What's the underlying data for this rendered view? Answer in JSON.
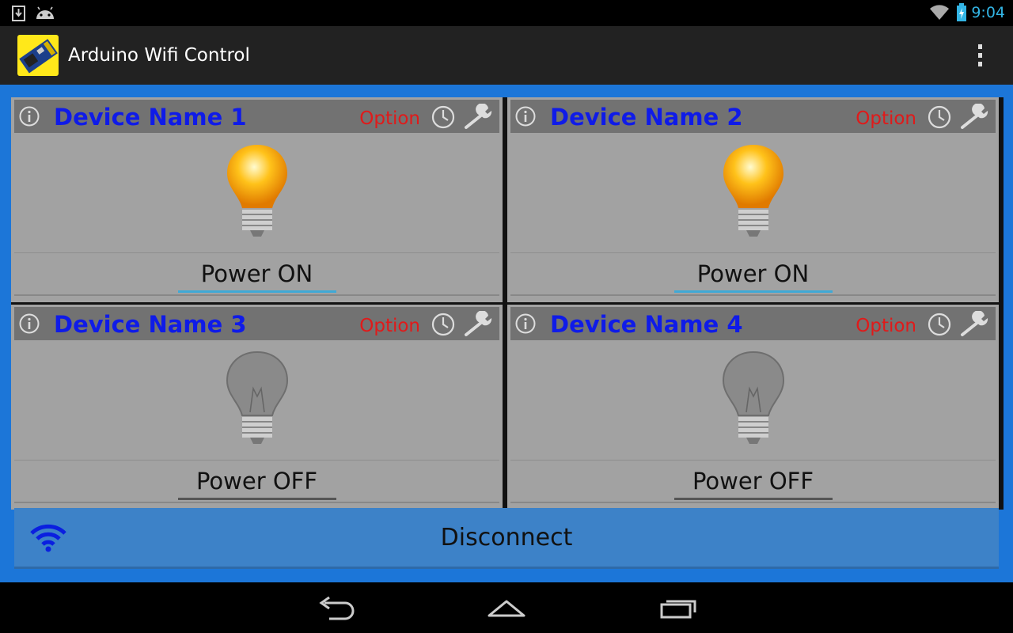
{
  "status_bar": {
    "time": "9:04",
    "left_icons": [
      "download-icon",
      "android-icon"
    ],
    "right_icons": [
      "wifi-signal-icon",
      "battery-charging-icon"
    ]
  },
  "app": {
    "title": "Arduino Wifi Control",
    "icon": "esp8266-module-icon"
  },
  "devices": [
    {
      "name": "Device Name 1",
      "option_label": "Option",
      "power_label": "Power ON",
      "state": "on"
    },
    {
      "name": "Device Name 2",
      "option_label": "Option",
      "power_label": "Power ON",
      "state": "on"
    },
    {
      "name": "Device Name 3",
      "option_label": "Option",
      "power_label": "Power OFF",
      "state": "off"
    },
    {
      "name": "Device Name 4",
      "option_label": "Option",
      "power_label": "Power OFF",
      "state": "off"
    }
  ],
  "disconnect": {
    "label": "Disconnect"
  },
  "colors": {
    "content_bg": "#1c76d8",
    "device_name": "#0f1be8",
    "option": "#e01a1a",
    "time": "#33b5e5"
  },
  "nav": [
    "back-icon",
    "home-icon",
    "recent-apps-icon"
  ]
}
